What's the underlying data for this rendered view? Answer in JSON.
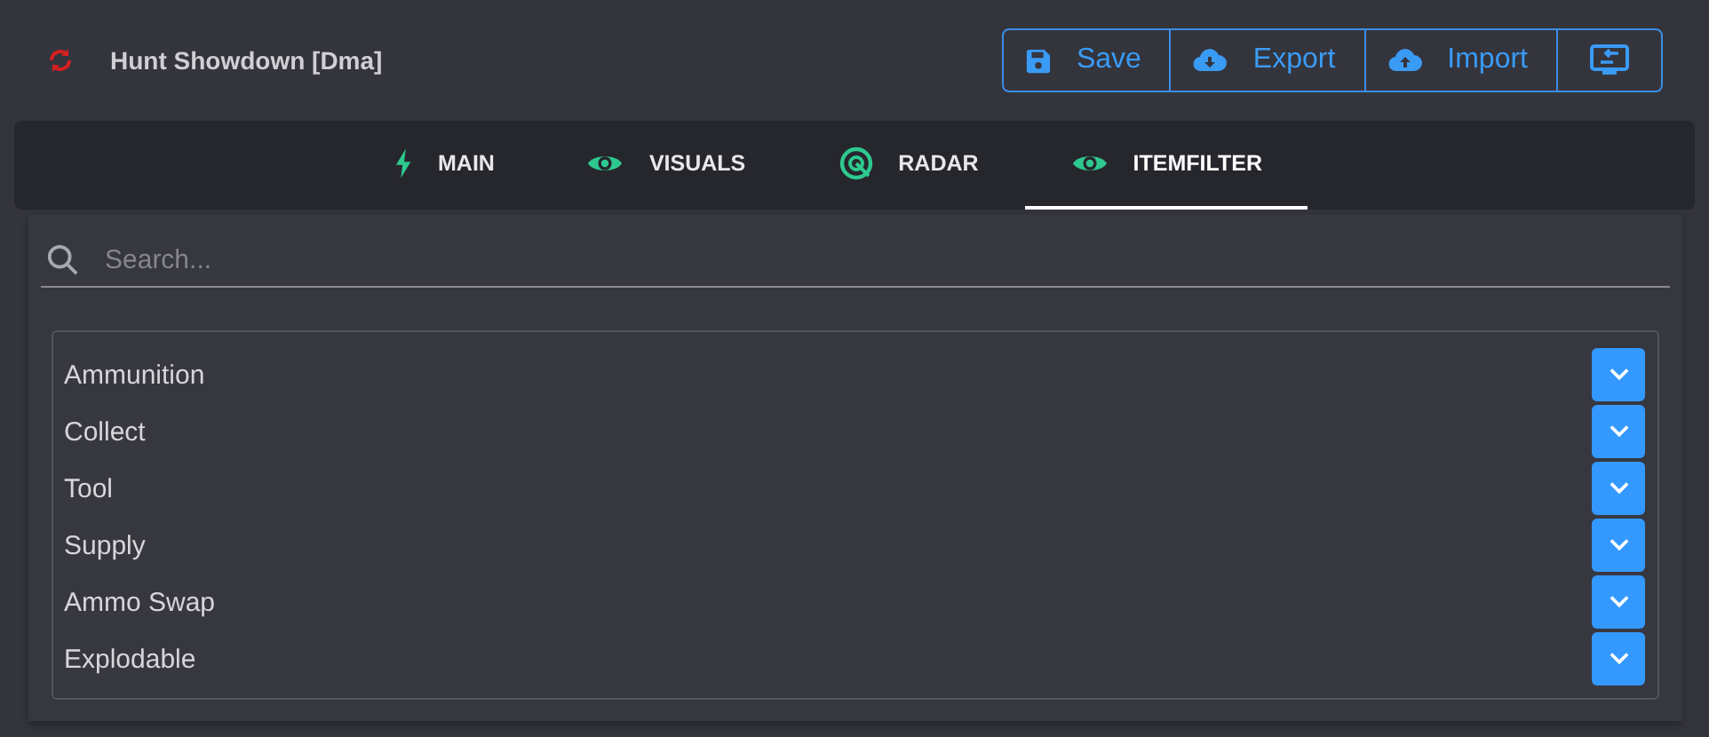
{
  "header": {
    "title": "Hunt Showdown [Dma]"
  },
  "toolbar": [
    {
      "label": "Save"
    },
    {
      "label": "Export"
    },
    {
      "label": "Import"
    }
  ],
  "tabs": [
    {
      "label": "MAIN",
      "selected": false
    },
    {
      "label": "VISUALS",
      "selected": false
    },
    {
      "label": "RADAR",
      "selected": false
    },
    {
      "label": "ITEMFILTER",
      "selected": true
    }
  ],
  "search": {
    "placeholder": "Search..."
  },
  "categories": [
    {
      "name": "Ammunition",
      "expanded": false
    },
    {
      "name": "Collect",
      "expanded": false
    },
    {
      "name": "Tool",
      "expanded": false
    },
    {
      "name": "Supply",
      "expanded": false
    },
    {
      "name": "Ammo Swap",
      "expanded": false
    },
    {
      "name": "Explodable",
      "expanded": false
    }
  ]
}
